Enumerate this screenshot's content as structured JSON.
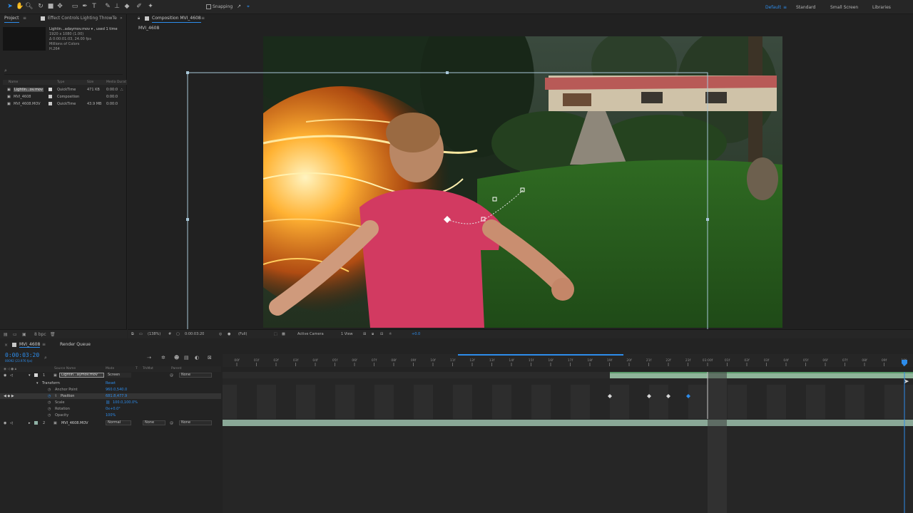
{
  "toolbar": {
    "snapping_label": "Snapping",
    "workspaces": [
      "Default",
      "Standard",
      "Small Screen",
      "Libraries"
    ]
  },
  "project_panel": {
    "tab_label": "Project",
    "effect_controls_tab": "Effect Controls Lighting ThrowTe",
    "file_info": {
      "title": "Lightin...adaymov.mov ▾ , used 1 time",
      "line1": "1920 x 1080 (1.00)",
      "line2": "Δ 0:00:01:03, 24.00 fps",
      "line3": "Millions of Colors",
      "line4": "H.264"
    },
    "search_icon": "magnifier",
    "columns": [
      "Name",
      "Type",
      "Size",
      "Media Durat"
    ],
    "items": [
      {
        "name": "Lightin...ov.mov",
        "type": "QuickTime",
        "size": "471 KB",
        "duration": "0:00:0",
        "color": "#d8d8d8"
      },
      {
        "name": "MVI_4608",
        "type": "Composition",
        "size": "",
        "duration": "0:00:0",
        "color": "#c8c8c8"
      },
      {
        "name": "MVI_4608.MOV",
        "type": "QuickTime",
        "size": "43.9 MB",
        "duration": "0:00:0",
        "color": "#c8c8c8"
      }
    ],
    "bpc_label": "8 bpc"
  },
  "composition": {
    "tab_label": "Composition MVI_4608",
    "breadcrumb": "MVI_4608"
  },
  "viewer_bar": {
    "zoom": "(138%)",
    "timecode": "0:00:03:20",
    "resolution": "(Full)",
    "camera": "Active Camera",
    "views": "1 View",
    "exposure": "+0.0"
  },
  "timeline": {
    "tab_label": "MVI_4608",
    "render_queue_label": "Render Queue",
    "timecode": "0:00:03:20",
    "timecode_sub": "00092 (23.976 fps)",
    "columns": [
      "Source Name",
      "Mode",
      "T",
      "TrkMat",
      "Parent"
    ],
    "layers": [
      {
        "index": "1",
        "name": "Lightin...aymov.mov",
        "mode": "Screen",
        "trkmat": "",
        "parent": "None"
      },
      {
        "index": "2",
        "name": "MVI_4608.MOV",
        "mode": "Normal",
        "trkmat": "None",
        "parent": "None"
      }
    ],
    "transform_label": "Transform",
    "reset_label": "Reset",
    "properties": [
      {
        "name": "Anchor Point",
        "value": "960.0,540.0"
      },
      {
        "name": "Position",
        "value": "681.8,477.9"
      },
      {
        "name": "Scale",
        "value": "100.0,100.0%"
      },
      {
        "name": "Rotation",
        "value": "0x+0.0°"
      },
      {
        "name": "Opacity",
        "value": "100%"
      }
    ],
    "ruler_labels": [
      "00f",
      "01f",
      "02f",
      "03f",
      "04f",
      "05f",
      "06f",
      "07f",
      "08f",
      "09f",
      "10f",
      "11f",
      "12f",
      "13f",
      "14f",
      "15f",
      "16f",
      "17f",
      "18f",
      "19f",
      "20f",
      "21f",
      "22f",
      "23f",
      "03:00f",
      "01f",
      "02f",
      "03f",
      "04f",
      "05f",
      "06f",
      "07f",
      "08f",
      "09f",
      "10f",
      "11f",
      "12f",
      "13f",
      "14f",
      "15f",
      "16f",
      "17f",
      "18f",
      "19f"
    ]
  }
}
